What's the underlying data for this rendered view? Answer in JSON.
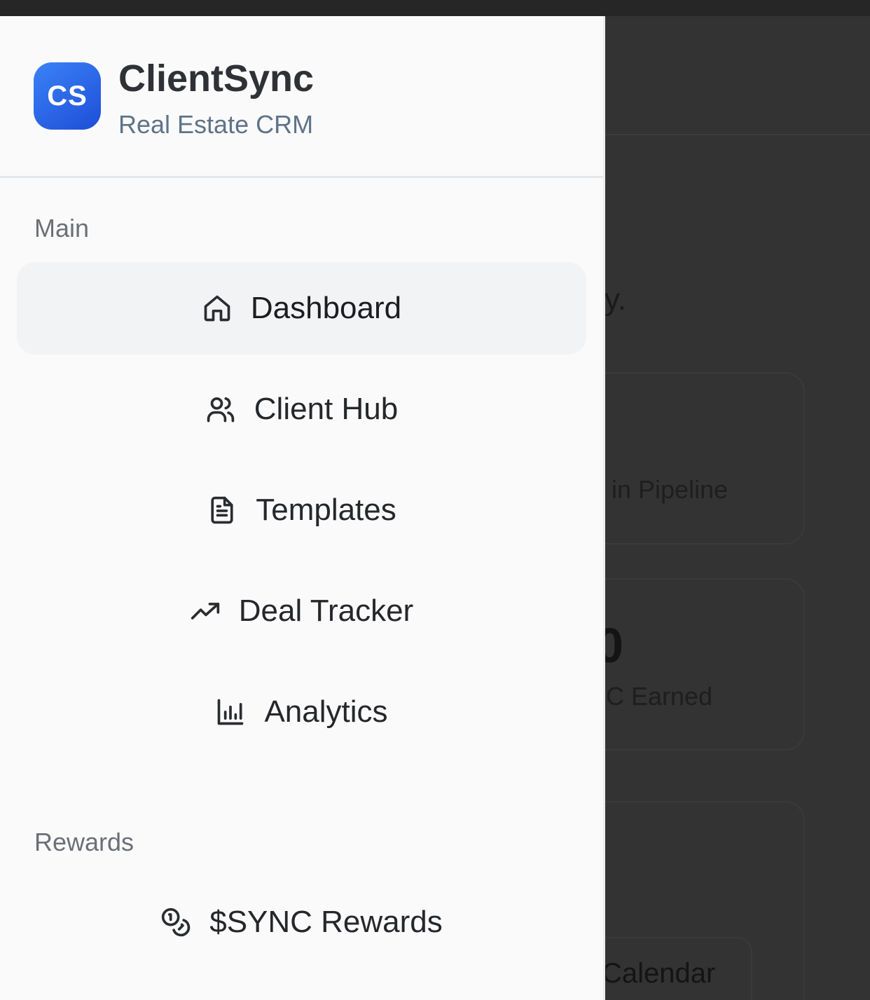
{
  "brand": {
    "logo_text": "CS",
    "name": "ClientSync",
    "subtitle": "Real Estate CRM",
    "accent_color": "#2563eb"
  },
  "sections": {
    "main": "Main",
    "rewards": "Rewards"
  },
  "nav": {
    "dashboard": {
      "label": "Dashboard",
      "icon": "home-icon",
      "active": true
    },
    "client_hub": {
      "label": "Client Hub",
      "icon": "users-icon"
    },
    "templates": {
      "label": "Templates",
      "icon": "document-icon"
    },
    "deal_tracker": {
      "label": "Deal Tracker",
      "icon": "trending-up-icon"
    },
    "analytics": {
      "label": "Analytics",
      "icon": "bar-chart-icon"
    },
    "sync_rewards": {
      "label": "$SYNC Rewards",
      "icon": "coins-icon"
    }
  },
  "background": {
    "fragment_heading": "y.",
    "card_pipeline": "in Pipeline",
    "card_zero": "0",
    "card_earned": "C Earned",
    "card_calendar": "Calendar"
  }
}
